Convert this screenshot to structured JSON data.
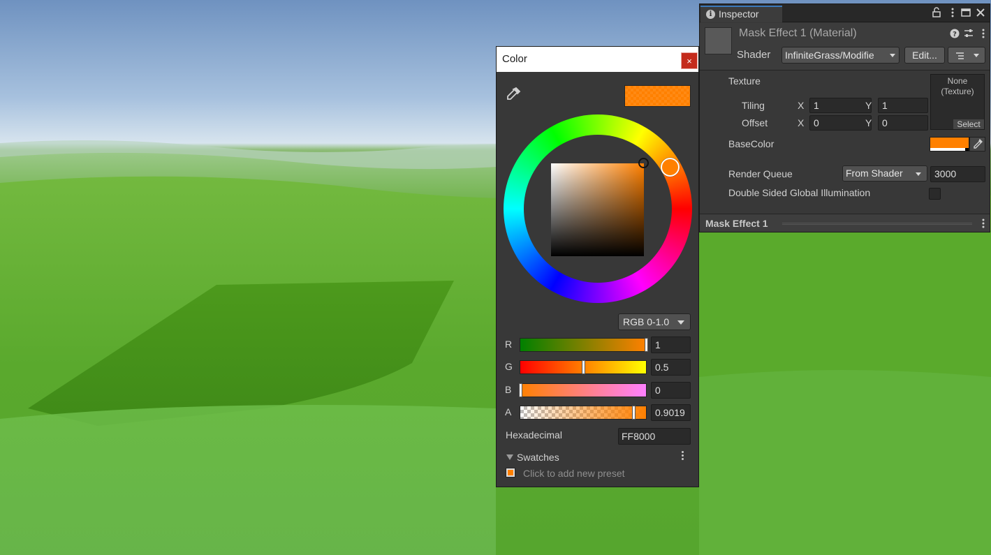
{
  "color_picker": {
    "title": "Color",
    "close_label": "×",
    "mode": "RGB 0-1.0",
    "channels": [
      {
        "label": "R",
        "value": "1",
        "fraction": 1.0
      },
      {
        "label": "G",
        "value": "0.5",
        "fraction": 0.5
      },
      {
        "label": "B",
        "value": "0",
        "fraction": 0.0
      },
      {
        "label": "A",
        "value": "0.9019",
        "fraction": 0.9019
      }
    ],
    "hex_label": "Hexadecimal",
    "hex_value": "FF8000",
    "swatches_label": "Swatches",
    "add_preset": "Click to add new preset",
    "current_color": "#ff8000"
  },
  "inspector": {
    "tab_label": "Inspector",
    "material_name": "Mask Effect 1 (Material)",
    "shader_label": "Shader",
    "shader_value": "InfiniteGrass/Modifie",
    "edit_label": "Edit...",
    "texture_label": "Texture",
    "tiling_label": "Tiling",
    "offset_label": "Offset",
    "x_label": "X",
    "y_label": "Y",
    "tiling_x": "1",
    "tiling_y": "1",
    "offset_x": "0",
    "offset_y": "0",
    "texture_none": "None\n(Texture)",
    "texture_select": "Select",
    "basecolor_label": "BaseColor",
    "render_queue_label": "Render Queue",
    "render_queue_mode": "From Shader",
    "render_queue_value": "3000",
    "dsgi_label": "Double Sided Global Illumination",
    "footer_title": "Mask Effect 1"
  }
}
